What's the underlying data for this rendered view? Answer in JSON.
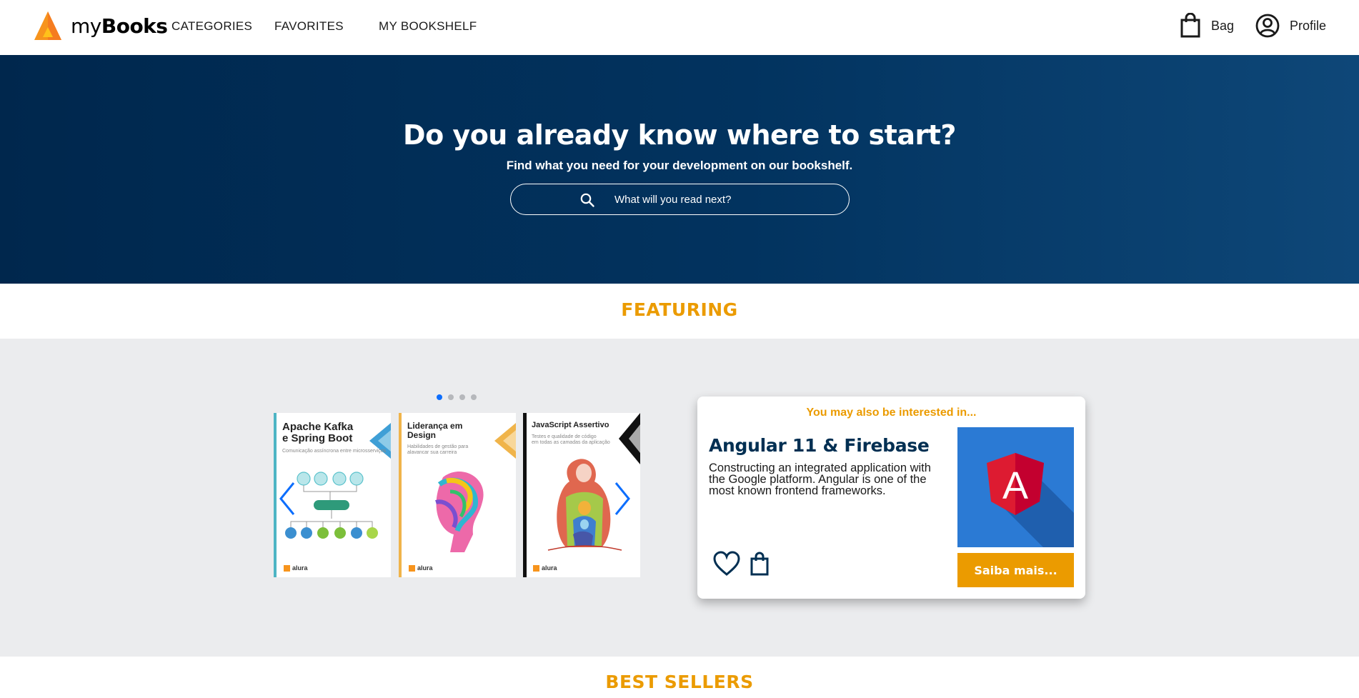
{
  "app": {
    "name_light": "my",
    "name_bold": "Books"
  },
  "nav": {
    "items": [
      {
        "label": "CATEGORIES"
      },
      {
        "label": "FAVORITES"
      },
      {
        "label": "MY BOOKSHELF"
      }
    ],
    "bag_label": "Bag",
    "profile_label": "Profile"
  },
  "hero": {
    "title": "Do you already know where to start?",
    "subtitle": "Find what you need for your development on our bookshelf.",
    "search_placeholder": "What will you read next?"
  },
  "featuring": {
    "title": "FEATURING",
    "carousel_page": 1,
    "carousel_pages": 4,
    "books": [
      {
        "title_line1": "Apache Kafka",
        "title_line2": "e Spring Boot",
        "subtitle": "Comunicação assíncrona entre microsserviços",
        "publisher": "alura"
      },
      {
        "title_line1": "Liderança em",
        "title_line2": "Design",
        "subtitle_line1": "Habilidades de gestão para",
        "subtitle_line2": "alavancar sua carreira",
        "publisher": "alura"
      },
      {
        "title_line1": "JavaScript Assertivo",
        "subtitle_line1": "Testes e qualidade de código",
        "subtitle_line2": "em todas as camadas da aplicação",
        "publisher": "alura"
      }
    ]
  },
  "recommendation": {
    "kicker": "You may also be interested in...",
    "title": "Angular 11 & Firebase",
    "description": "Constructing an integrated application with the Google platform. Angular is one of the most known frontend frameworks.",
    "button_label": "Saiba mais...",
    "cover_letter": "A"
  },
  "best_sellers": {
    "title": "BEST SELLERS"
  },
  "colors": {
    "accent": "#eb9b00",
    "hero_bg": "#00274d",
    "band_bg": "#ebecee",
    "carousel_active": "#0d6efd",
    "angular_red": "#dd1b31",
    "angular_blue": "#2b7ad4"
  },
  "icons": [
    "logo-icon",
    "bag-icon",
    "profile-icon",
    "search-icon",
    "chevron-left-icon",
    "chevron-right-icon",
    "heart-icon",
    "bag-icon",
    "angular-logo-icon"
  ]
}
